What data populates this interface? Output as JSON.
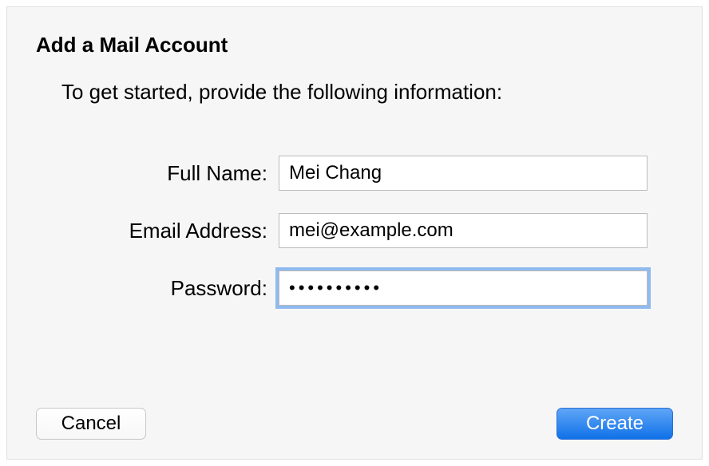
{
  "header": {
    "title": "Add a Mail Account",
    "subtitle": "To get started, provide the following information:"
  },
  "form": {
    "full_name": {
      "label": "Full Name:",
      "value": "Mei Chang"
    },
    "email": {
      "label": "Email Address:",
      "value": "mei@example.com"
    },
    "password": {
      "label": "Password:",
      "value": "••••••••••"
    }
  },
  "buttons": {
    "cancel": "Cancel",
    "create": "Create"
  },
  "colors": {
    "background": "#f6f6f6",
    "focus_ring": "#8fbaf0",
    "primary_button": "#1a7ff2"
  }
}
